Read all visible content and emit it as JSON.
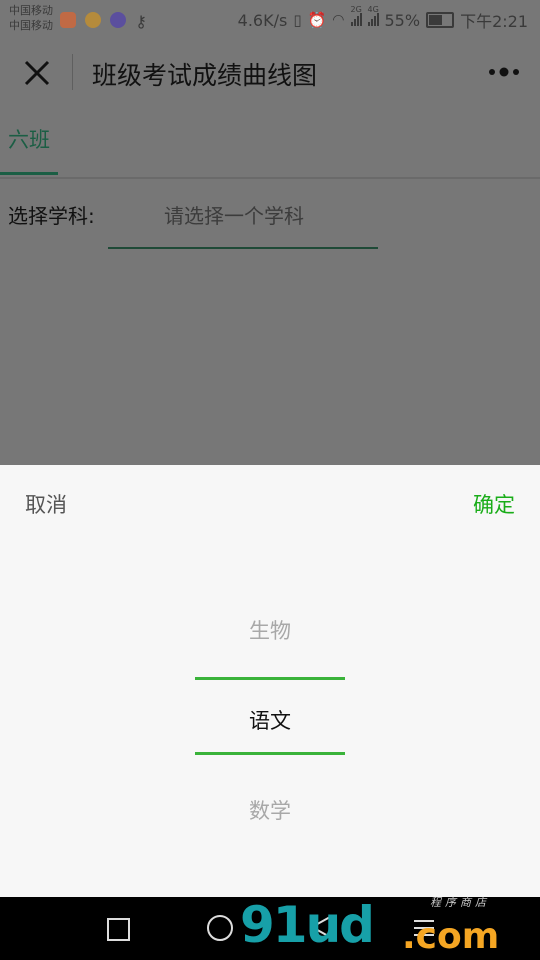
{
  "status_bar": {
    "carrier_1": "中国移动",
    "carrier_2": "中国移动",
    "speed": "4.6K/s",
    "net_1": "2G",
    "net_2": "4G",
    "battery": "55%",
    "battery_level": 0.55,
    "time": "下午2:21"
  },
  "nav": {
    "title": "班级考试成绩曲线图",
    "close_icon": "close-icon",
    "more_icon": "more-icon"
  },
  "tabs": [
    {
      "label": "六班",
      "active": true
    }
  ],
  "form": {
    "subject_label": "选择学科:",
    "subject_placeholder": "请选择一个学科"
  },
  "picker": {
    "cancel": "取消",
    "confirm": "确定",
    "options": [
      "生物",
      "语文",
      "数学"
    ],
    "selected": "语文"
  },
  "colors": {
    "accent": "#1aad19",
    "tab_active": "#1b5e44"
  },
  "watermark": {
    "main": "91ud",
    "domain": ".com",
    "cn": "程序商店"
  }
}
